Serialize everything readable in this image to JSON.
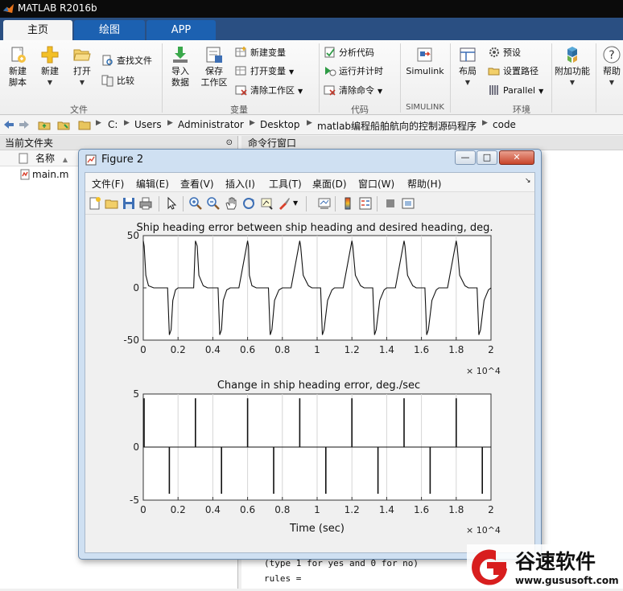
{
  "app": {
    "title": "MATLAB R2016b"
  },
  "tabs": [
    {
      "label": "主页",
      "active": true
    },
    {
      "label": "绘图",
      "active": false
    },
    {
      "label": "APP",
      "active": false
    }
  ],
  "ribbon": {
    "file": {
      "new_script": "新建\n脚本",
      "new": "新建",
      "open": "打开",
      "find_files": "查找文件",
      "compare": "比较",
      "section": "文件"
    },
    "variable": {
      "import": "导入\n数据",
      "save_ws": "保存\n工作区",
      "new_var": "新建变量",
      "open_var": "打开变量",
      "clear_ws": "清除工作区",
      "section": "变量"
    },
    "code": {
      "analyze": "分析代码",
      "run_time": "运行并计时",
      "clear_cmd": "清除命令",
      "section": "代码"
    },
    "simulink": {
      "label": "Simulink",
      "section": "SIMULINK"
    },
    "env": {
      "layout": "布局",
      "prefs": "预设",
      "set_path": "设置路径",
      "parallel": "Parallel",
      "section": "环境"
    },
    "addons": {
      "label": "附加功能"
    },
    "help": {
      "label": "帮助"
    }
  },
  "address": {
    "crumbs": [
      "C:",
      "Users",
      "Administrator",
      "Desktop",
      "matlab编程船舶航向的控制源码程序",
      "code"
    ]
  },
  "left_panel": {
    "title": "当前文件夹",
    "col_name": "名称",
    "sort_arrow": "▲",
    "files": [
      {
        "name": "main.m"
      }
    ]
  },
  "command_window": {
    "title": "命令行窗口",
    "lines": [
      "(type 1 for yes and 0 for no)",
      "rules ="
    ]
  },
  "figure": {
    "title": "Figure 2",
    "menus": [
      "文件(F)",
      "编辑(E)",
      "查看(V)",
      "插入(I)",
      "工具(T)",
      "桌面(D)",
      "窗口(W)",
      "帮助(H)"
    ],
    "min": "—",
    "max": "□",
    "close": "✕"
  },
  "chart_data": [
    {
      "type": "line",
      "title": "Ship heading error between ship heading and desired heading, deg.",
      "xlabel": "",
      "ylabel": "",
      "x_multiplier": "× 10^4",
      "xlim": [
        0,
        2
      ],
      "ylim": [
        -50,
        50
      ],
      "xticks": [
        "0",
        "0.2",
        "0.4",
        "0.6",
        "0.8",
        "1",
        "1.2",
        "1.4",
        "1.6",
        "1.8",
        "2"
      ],
      "yticks": [
        "-50",
        "0",
        "50"
      ],
      "grid": "vertical",
      "series": [
        {
          "x": [
            0,
            0.005,
            0.015,
            0.03,
            0.06,
            0.09,
            0.14,
            0.15,
            0.16,
            0.17,
            0.185,
            0.2,
            0.24,
            0.29,
            0.3,
            0.31,
            0.32,
            0.345,
            0.37,
            0.43,
            0.44,
            0.45,
            0.46,
            0.48,
            0.5,
            0.55,
            0.6,
            0.605,
            0.61,
            0.625,
            0.65,
            0.67,
            0.72,
            0.73,
            0.74,
            0.755,
            0.78,
            0.8,
            0.85,
            0.9,
            0.905,
            0.92,
            0.95,
            0.97,
            1.02,
            1.03,
            1.04,
            1.06,
            1.085,
            1.1,
            1.15,
            1.2,
            1.205,
            1.22,
            1.25,
            1.27,
            1.32,
            1.33,
            1.34,
            1.36,
            1.385,
            1.4,
            1.45,
            1.5,
            1.505,
            1.52,
            1.55,
            1.57,
            1.62,
            1.63,
            1.64,
            1.66,
            1.685,
            1.7,
            1.75,
            1.8,
            1.805,
            1.82,
            1.85,
            1.87,
            1.92,
            1.93,
            1.94,
            1.96,
            1.985,
            2.0
          ],
          "y": [
            45,
            40,
            12,
            2,
            0,
            0,
            0,
            -45,
            -40,
            -12,
            -2,
            0,
            0,
            0,
            45,
            40,
            12,
            2,
            0,
            0,
            -45,
            -40,
            -12,
            -2,
            0,
            0,
            45,
            40,
            12,
            2,
            0,
            0,
            0,
            -45,
            -40,
            -12,
            -2,
            0,
            0,
            45,
            40,
            12,
            2,
            0,
            0,
            -45,
            -40,
            -12,
            -2,
            0,
            0,
            45,
            40,
            12,
            2,
            0,
            0,
            -45,
            -40,
            -12,
            -2,
            0,
            0,
            45,
            40,
            12,
            2,
            0,
            0,
            -45,
            -40,
            -12,
            -2,
            0,
            0,
            45,
            40,
            12,
            2,
            0,
            0,
            -45,
            -40,
            -12,
            -2,
            0
          ]
        }
      ]
    },
    {
      "type": "line",
      "title": "Change in ship heading error, deg./sec",
      "xlabel": "Time (sec)",
      "ylabel": "",
      "x_multiplier": "× 10^4",
      "xlim": [
        0,
        2
      ],
      "ylim": [
        -5,
        5
      ],
      "xticks": [
        "0",
        "0.2",
        "0.4",
        "0.6",
        "0.8",
        "1",
        "1.2",
        "1.4",
        "1.6",
        "1.8",
        "2"
      ],
      "yticks": [
        "-5",
        "0",
        "5"
      ],
      "grid": "vertical",
      "series": [
        {
          "spike_x": [
            0.0,
            0.15,
            0.3,
            0.45,
            0.6,
            0.75,
            0.9,
            1.05,
            1.2,
            1.35,
            1.5,
            1.65,
            1.8,
            1.95
          ],
          "spike_y": [
            4.6,
            -4.4,
            4.6,
            -4.4,
            4.6,
            -4.4,
            4.6,
            -4.4,
            4.6,
            -4.4,
            4.6,
            -4.4,
            4.6,
            -4.4
          ]
        }
      ]
    }
  ],
  "watermark": {
    "brand": "谷速软件",
    "url": "www.gususoft.com"
  }
}
